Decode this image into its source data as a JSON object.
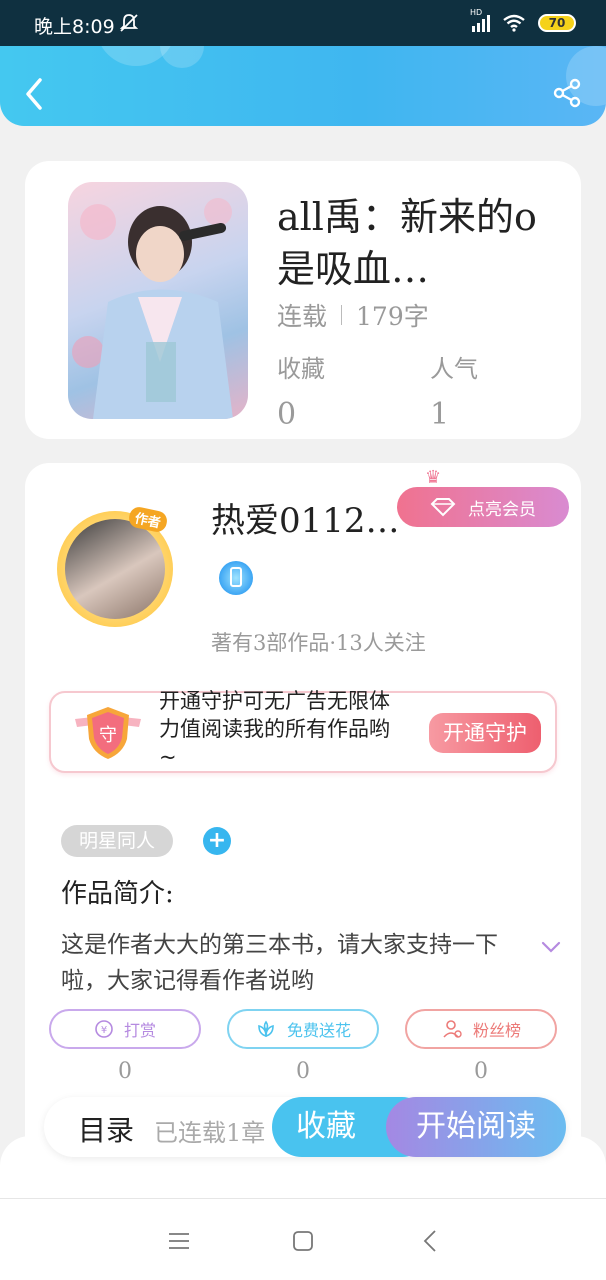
{
  "status_bar": {
    "time": "晚上8:09",
    "battery": "70",
    "network": "HD"
  },
  "book": {
    "title": "all禹：新来的o是吸血…",
    "status": "连载",
    "word_count": "179字",
    "stats": [
      {
        "label": "收藏",
        "value": "0"
      },
      {
        "label": "人气",
        "value": "1"
      }
    ]
  },
  "author": {
    "tag": "作者",
    "name": "热爱0112…",
    "vip_label": "点亮会员",
    "works": "著有3部作品·13人关注"
  },
  "guard": {
    "icon_char": "守",
    "text": "开通守护可无广告无限体力值阅读我的所有作品哟~",
    "button": "开通守护"
  },
  "tags": {
    "category": "明星同人",
    "add": "+"
  },
  "intro": {
    "title": "作品简介:",
    "text": "这是作者大大的第三本书，请大家支持一下啦，大家记得看作者说哟"
  },
  "actions": [
    {
      "label": "打赏",
      "icon": "coin-icon",
      "count": "0",
      "color": "#b58ae0"
    },
    {
      "label": "免费送花",
      "icon": "flower-icon",
      "count": "0",
      "color": "#4cc3ee"
    },
    {
      "label": "粉丝榜",
      "icon": "fans-icon",
      "count": "0",
      "color": "#ec7a78"
    }
  ],
  "bottom": {
    "catalog": "目录",
    "catalog_status": "已连载1章",
    "favorite": "收藏",
    "read": "开始阅读"
  }
}
